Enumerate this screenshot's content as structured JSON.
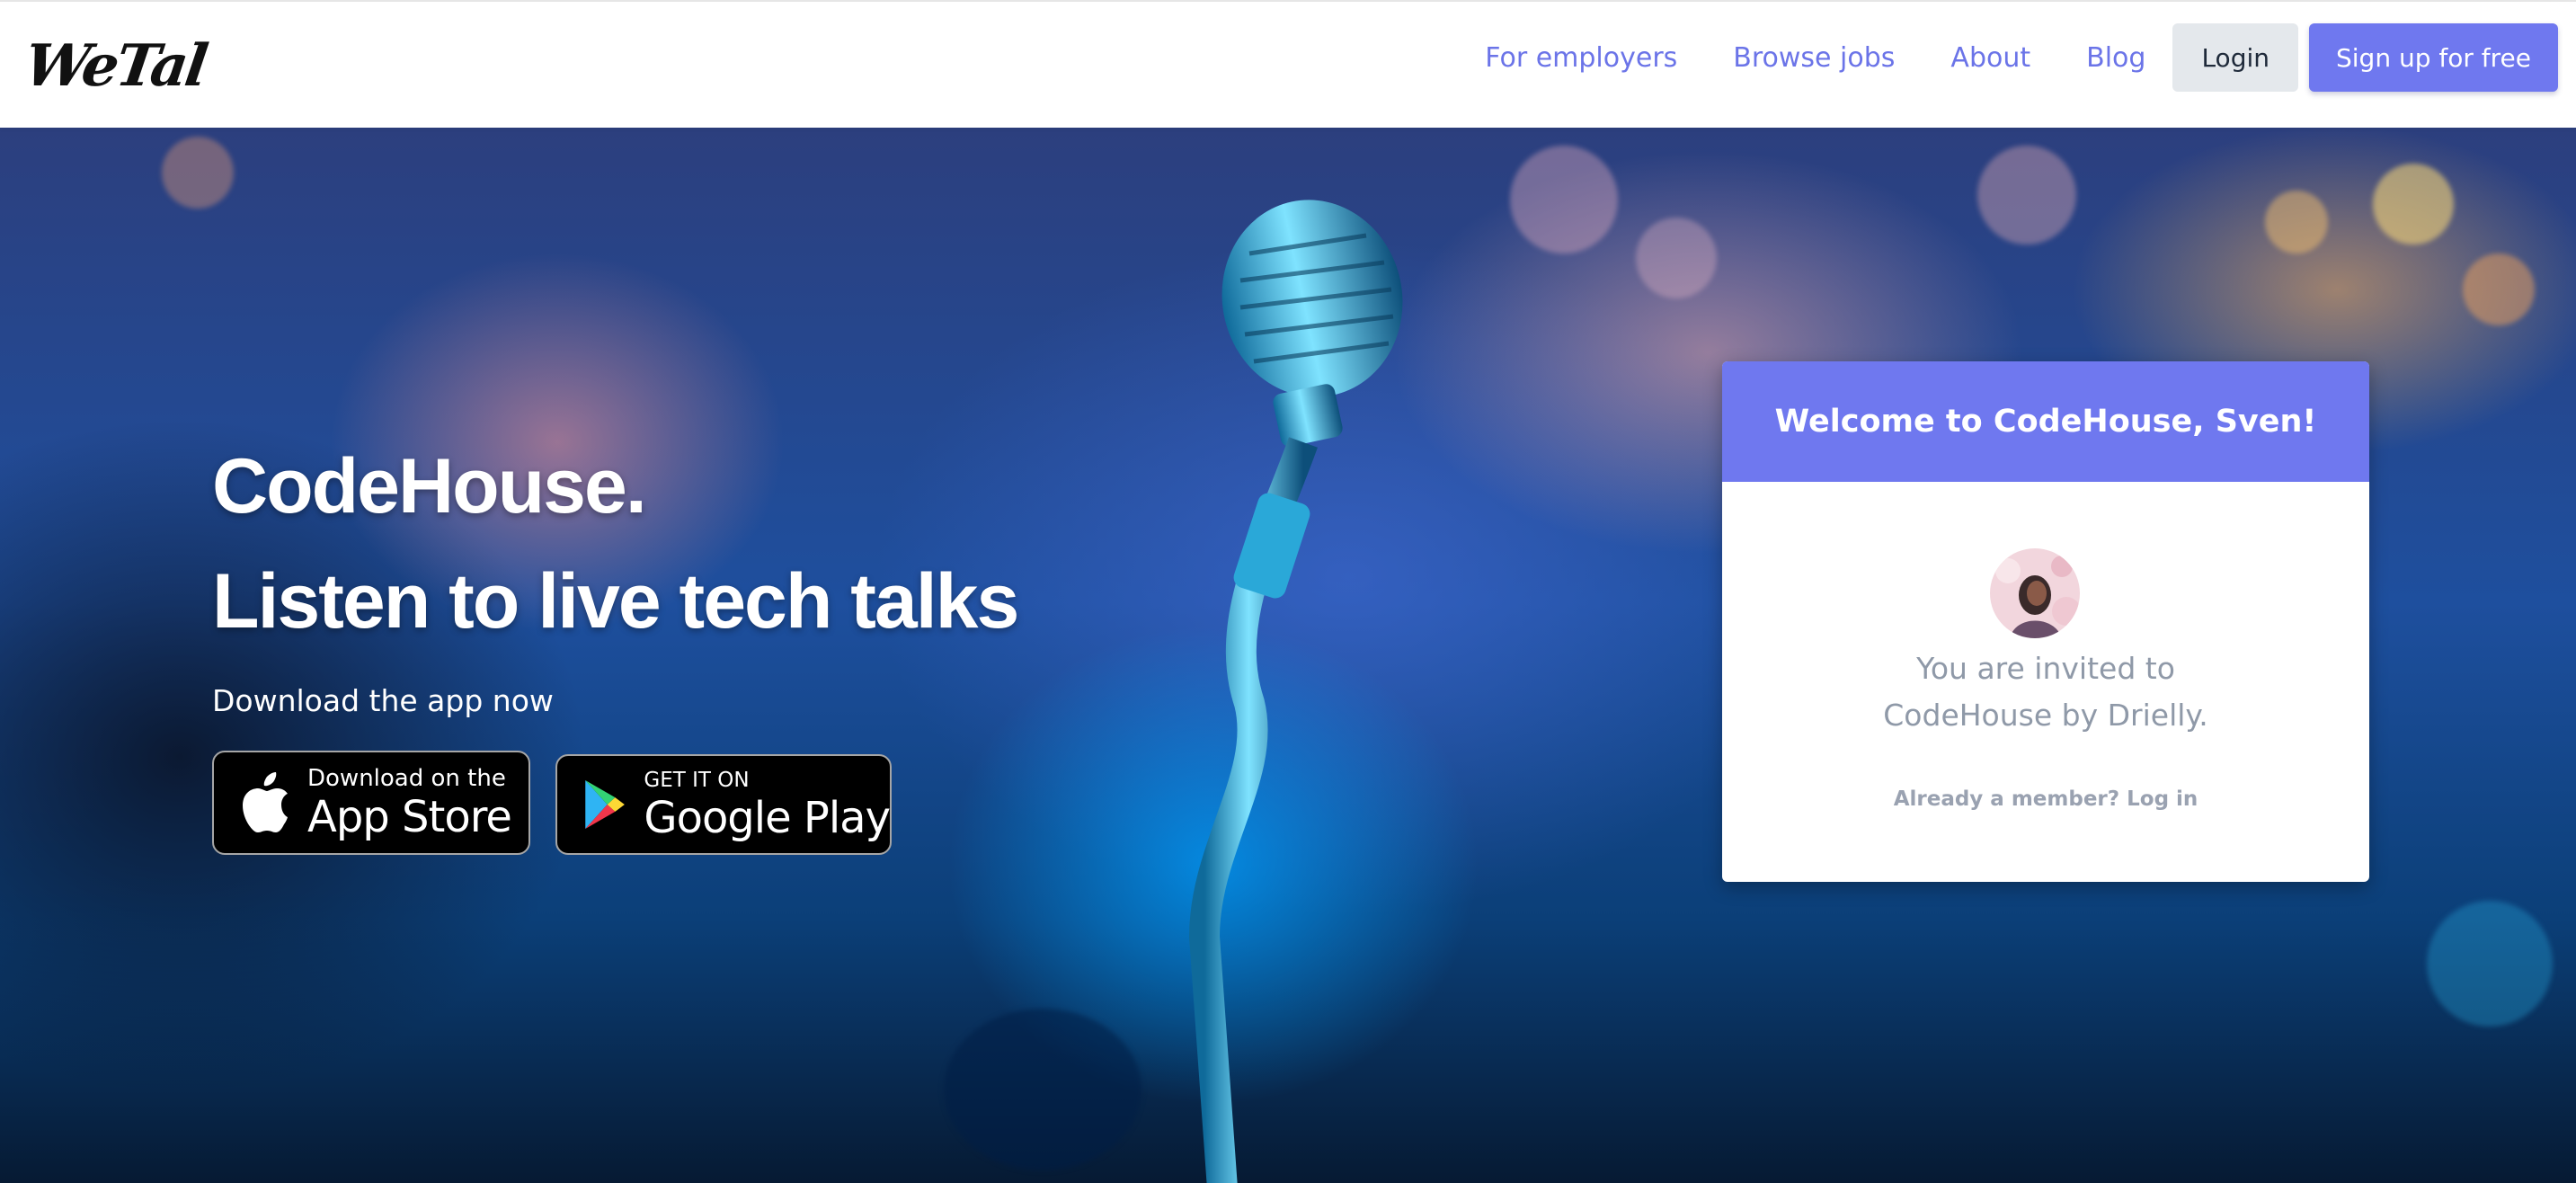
{
  "navbar": {
    "logo_text": "WeTal",
    "links": [
      {
        "label": "For employers"
      },
      {
        "label": "Browse jobs"
      },
      {
        "label": "About"
      },
      {
        "label": "Blog"
      }
    ],
    "login_label": "Login",
    "signup_label": "Sign up for free"
  },
  "hero": {
    "title_line1": "CodeHouse.",
    "title_line2": "Listen to live tech talks",
    "download_text": "Download the app now",
    "app_store": {
      "small": "Download on the",
      "big": "App Store",
      "icon": "apple-icon"
    },
    "google_play": {
      "small": "GET IT ON",
      "big": "Google Play",
      "icon": "google-play-icon"
    }
  },
  "card": {
    "header": "Welcome to CodeHouse, Sven!",
    "invite_line1": "You are invited to",
    "invite_line2": "CodeHouse by Drielly.",
    "member_link": "Already a member? Log in"
  },
  "colors": {
    "accent": "#6f78ef",
    "nav_link": "#6b74e8",
    "login_bg": "#e4e8ec",
    "muted_text": "#8f99a8"
  }
}
